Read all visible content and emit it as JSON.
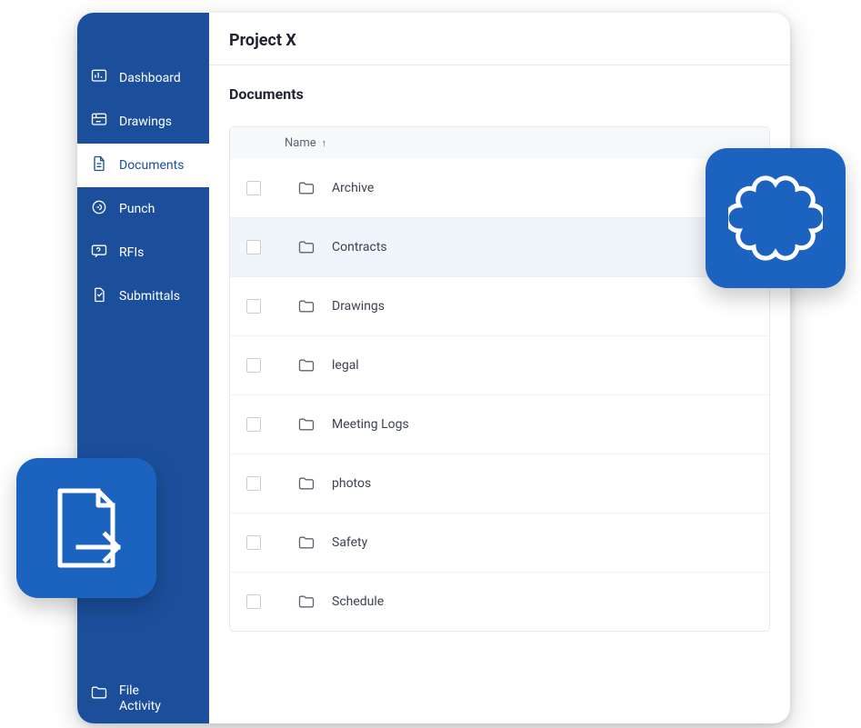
{
  "header": {
    "title": "Project X"
  },
  "main": {
    "section_title": "Documents",
    "column_header": "Name",
    "sort_indicator": "↑",
    "rows": [
      {
        "name": "Archive",
        "highlight": false
      },
      {
        "name": "Contracts",
        "highlight": true
      },
      {
        "name": "Drawings",
        "highlight": false
      },
      {
        "name": "legal",
        "highlight": false
      },
      {
        "name": "Meeting Logs",
        "highlight": false
      },
      {
        "name": "photos",
        "highlight": false
      },
      {
        "name": "Safety",
        "highlight": false
      },
      {
        "name": "Schedule",
        "highlight": false
      }
    ]
  },
  "sidebar": {
    "items": [
      {
        "label": "Dashboard",
        "icon": "dashboard-icon",
        "active": false
      },
      {
        "label": "Drawings",
        "icon": "drawings-icon",
        "active": false
      },
      {
        "label": "Documents",
        "icon": "documents-icon",
        "active": true
      },
      {
        "label": "Punch",
        "icon": "punch-icon",
        "active": false
      },
      {
        "label": "RFIs",
        "icon": "rfi-icon",
        "active": false
      },
      {
        "label": "Submittals",
        "icon": "submittals-icon",
        "active": false
      }
    ],
    "footer": {
      "label": "File\nActivity",
      "icon": "folder-icon"
    }
  },
  "badges": {
    "left": {
      "name": "export-file-badge"
    },
    "right": {
      "name": "flower-badge"
    }
  }
}
